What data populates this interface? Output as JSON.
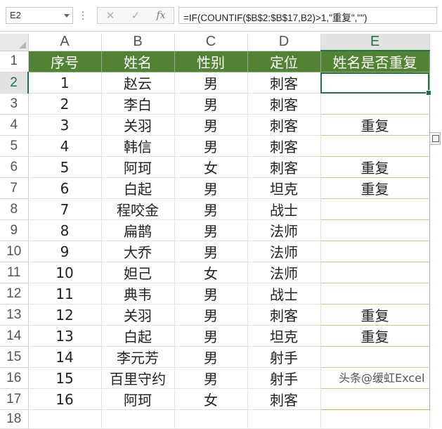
{
  "formula_bar": {
    "name_box": "E2",
    "cancel_icon": "✕",
    "enter_icon": "✓",
    "function_icon": "fx",
    "formula": "=IF(COUNTIF($B$2:$B$17,B2)>1,\"重复\",\"\")"
  },
  "sheet": {
    "columns": [
      "A",
      "B",
      "C",
      "D",
      "E"
    ],
    "header_row": {
      "row_num": "1",
      "cells": [
        "序号",
        "姓名",
        "性别",
        "定位",
        "姓名是否重复"
      ]
    },
    "rows": [
      {
        "row_num": "2",
        "cells": [
          "1",
          "赵云",
          "男",
          "刺客",
          ""
        ]
      },
      {
        "row_num": "3",
        "cells": [
          "2",
          "李白",
          "男",
          "刺客",
          ""
        ]
      },
      {
        "row_num": "4",
        "cells": [
          "3",
          "关羽",
          "男",
          "刺客",
          "重复"
        ]
      },
      {
        "row_num": "5",
        "cells": [
          "4",
          "韩信",
          "男",
          "刺客",
          ""
        ]
      },
      {
        "row_num": "6",
        "cells": [
          "5",
          "阿珂",
          "女",
          "刺客",
          "重复"
        ]
      },
      {
        "row_num": "7",
        "cells": [
          "6",
          "白起",
          "男",
          "坦克",
          "重复"
        ]
      },
      {
        "row_num": "8",
        "cells": [
          "7",
          "程咬金",
          "男",
          "战士",
          ""
        ]
      },
      {
        "row_num": "9",
        "cells": [
          "8",
          "扁鹊",
          "男",
          "法师",
          ""
        ]
      },
      {
        "row_num": "10",
        "cells": [
          "9",
          "大乔",
          "男",
          "法师",
          ""
        ]
      },
      {
        "row_num": "11",
        "cells": [
          "10",
          "妲己",
          "女",
          "法师",
          ""
        ]
      },
      {
        "row_num": "12",
        "cells": [
          "11",
          "典韦",
          "男",
          "战士",
          ""
        ]
      },
      {
        "row_num": "13",
        "cells": [
          "12",
          "关羽",
          "男",
          "刺客",
          "重复"
        ]
      },
      {
        "row_num": "14",
        "cells": [
          "13",
          "白起",
          "男",
          "坦克",
          "重复"
        ]
      },
      {
        "row_num": "15",
        "cells": [
          "14",
          "李元芳",
          "男",
          "射手",
          ""
        ]
      },
      {
        "row_num": "16",
        "cells": [
          "15",
          "百里守约",
          "男",
          "射手",
          ""
        ]
      },
      {
        "row_num": "17",
        "cells": [
          "16",
          "阿珂",
          "女",
          "刺客",
          ""
        ]
      }
    ],
    "partial_row_num": "18",
    "active_cell": "E2",
    "header_fill_color": "#548235",
    "selection_color": "#217346"
  },
  "watermark": "头条@缓虹Excel"
}
